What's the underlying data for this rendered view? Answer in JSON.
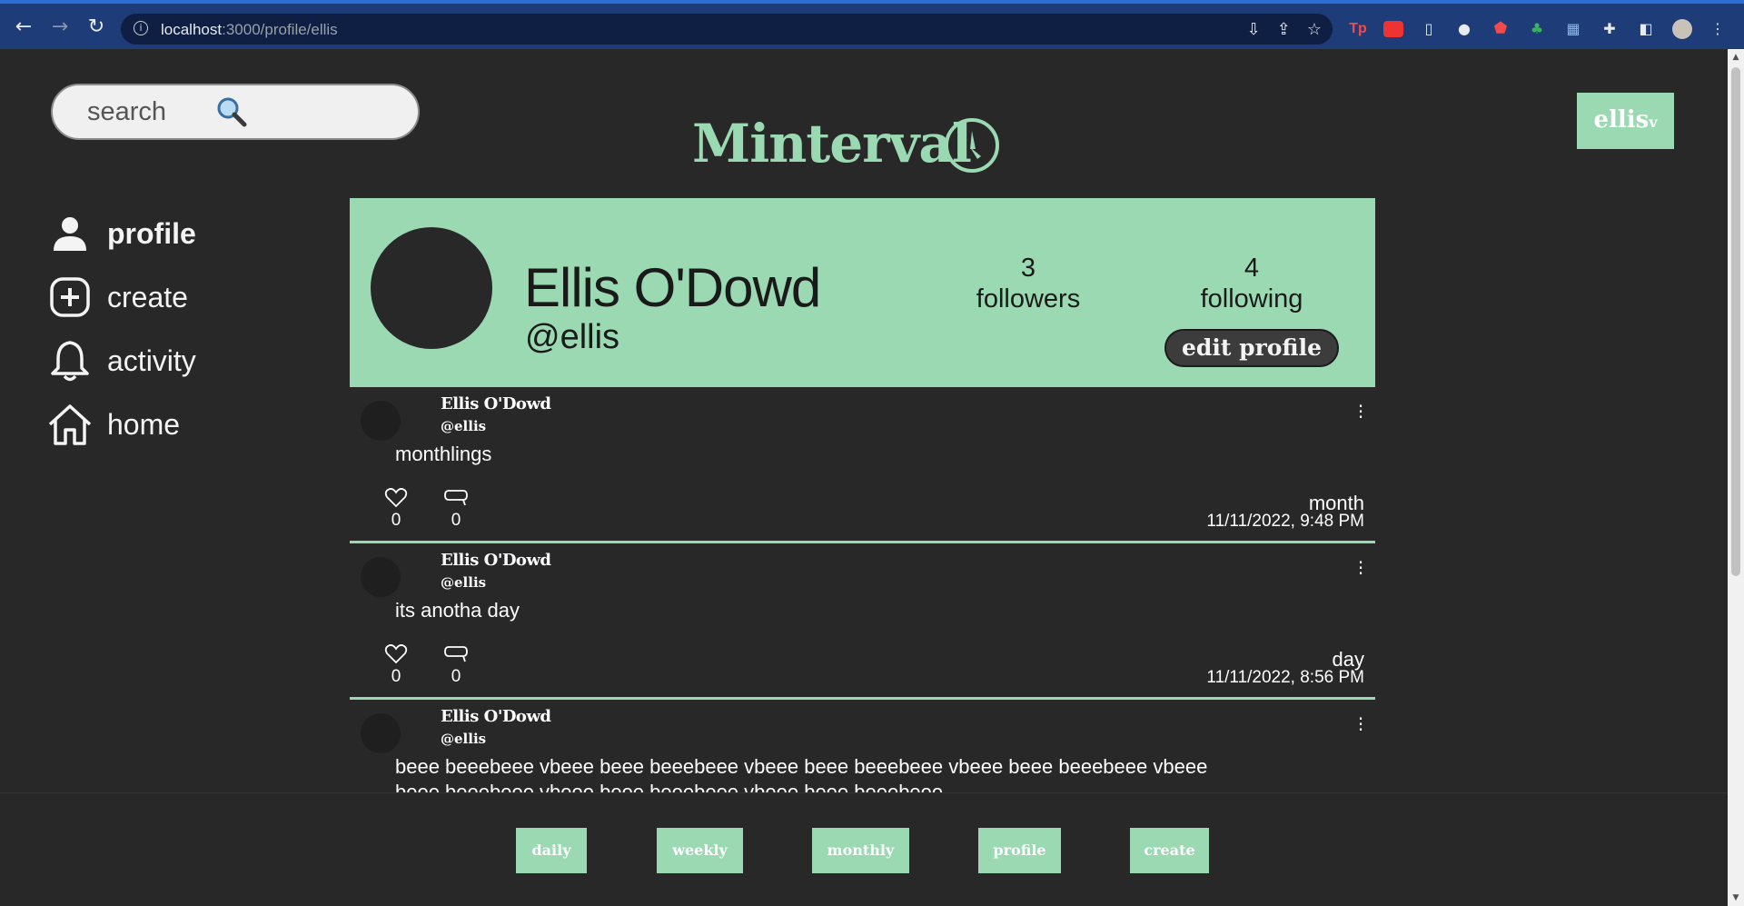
{
  "browser": {
    "url_host": "localhost",
    "url_path": ":3000/profile/ellis"
  },
  "search": {
    "placeholder": "search"
  },
  "brand": {
    "name": "Minterval"
  },
  "user_menu": {
    "label": "ellis",
    "caret": "v"
  },
  "sidenav": {
    "items": [
      {
        "label": "profile",
        "icon": "person-icon",
        "active": true
      },
      {
        "label": "create",
        "icon": "plus-circle-icon",
        "active": false
      },
      {
        "label": "activity",
        "icon": "bell-icon",
        "active": false
      },
      {
        "label": "home",
        "icon": "house-icon",
        "active": false
      }
    ]
  },
  "profile": {
    "name": "Ellis O'Dowd",
    "handle": "@ellis",
    "followers_count": "3",
    "followers_label": "followers",
    "following_count": "4",
    "following_label": "following",
    "edit_label": "edit profile"
  },
  "posts": [
    {
      "author": "Ellis O'Dowd",
      "handle": "@ellis",
      "text": "monthlings",
      "likes": "0",
      "comments": "0",
      "interval": "month",
      "date": "11/11/2022, 9:48 PM"
    },
    {
      "author": "Ellis O'Dowd",
      "handle": "@ellis",
      "text": "its anotha day",
      "likes": "0",
      "comments": "0",
      "interval": "day",
      "date": "11/11/2022, 8:56 PM"
    },
    {
      "author": "Ellis O'Dowd",
      "handle": "@ellis",
      "text": "beee beeebeee vbeee beee beeebeee vbeee beee beeebeee vbeee beee beeebeee vbeee beee beeebeee vbeee beee beeebeee vbeee beee beeebeee",
      "likes": "",
      "comments": "",
      "interval": "",
      "date": ""
    }
  ],
  "bottombar": {
    "buttons": [
      "daily",
      "weekly",
      "monthly",
      "profile",
      "create"
    ]
  },
  "colors": {
    "accent": "#9ad9b2",
    "background": "#282828",
    "browser_frame": "#1d3c78"
  }
}
